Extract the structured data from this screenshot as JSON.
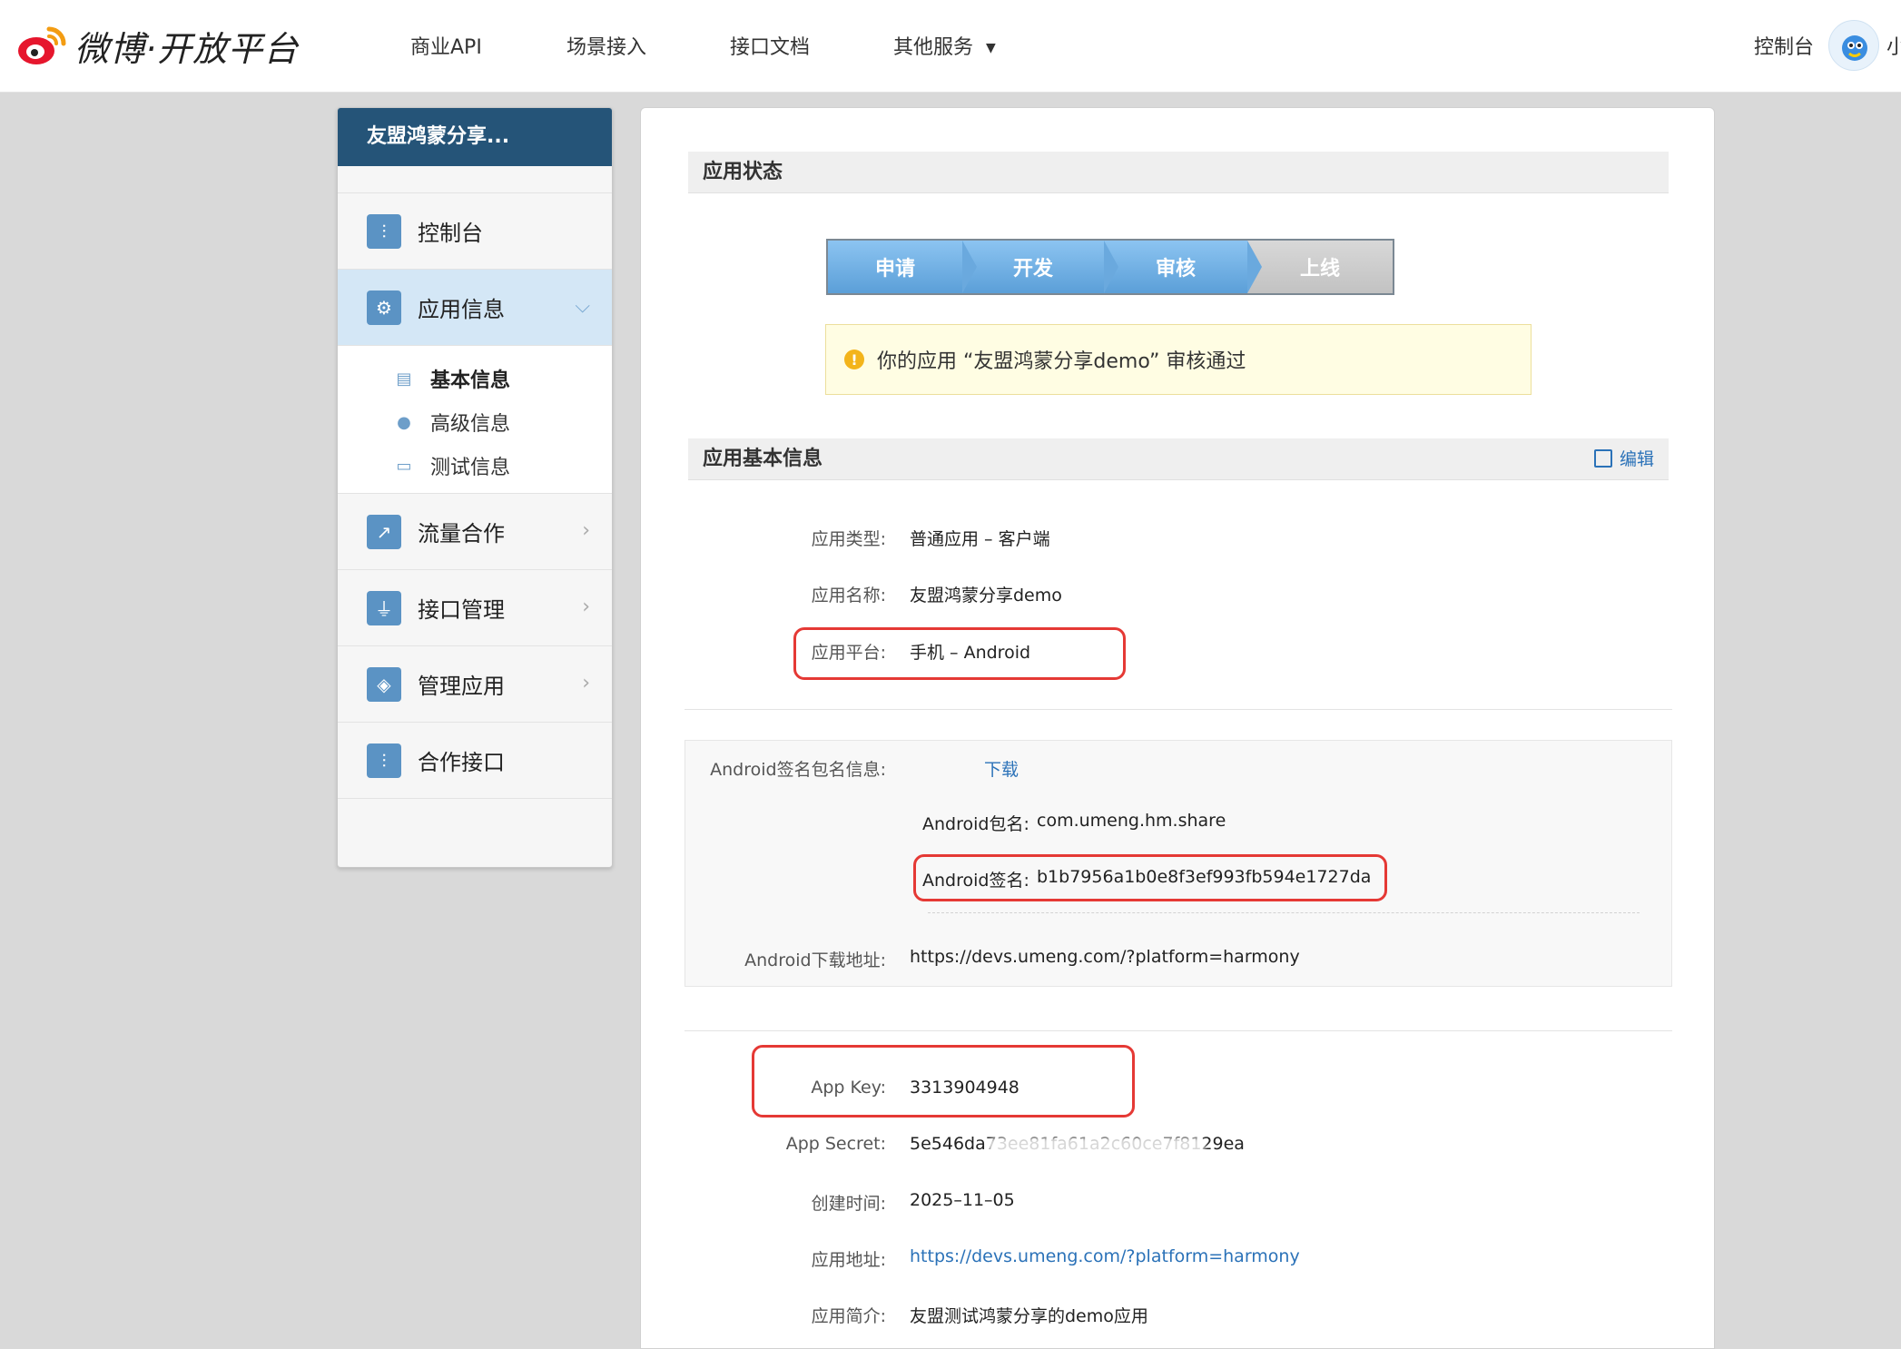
{
  "header": {
    "logo_text": "微博·开放平台",
    "nav": [
      "商业API",
      "场景接入",
      "接口文档",
      "其他服务"
    ],
    "console": "控制台",
    "user_initial": "小"
  },
  "sidebar": {
    "title": "友盟鸿蒙分享...",
    "items": [
      {
        "label": "控制台",
        "icon": "sliders-icon"
      },
      {
        "label": "应用信息",
        "icon": "gear-icon"
      },
      {
        "label": "流量合作",
        "icon": "line-chart-icon"
      },
      {
        "label": "接口管理",
        "icon": "plug-icon"
      },
      {
        "label": "管理应用",
        "icon": "layers-icon"
      },
      {
        "label": "合作接口",
        "icon": "sliders-icon"
      }
    ],
    "subitems": [
      {
        "label": "基本信息",
        "icon": "id-card-icon"
      },
      {
        "label": "高级信息",
        "icon": "info-circle-icon"
      },
      {
        "label": "测试信息",
        "icon": "test-card-icon"
      }
    ]
  },
  "status": {
    "title": "应用状态",
    "steps": [
      "申请",
      "开发",
      "审核",
      "上线"
    ],
    "notice": "你的应用 “友盟鸿蒙分享demo” 审核通过"
  },
  "basic": {
    "title": "应用基本信息",
    "edit": "编辑",
    "app_type_label": "应用类型:",
    "app_type_value": "普通应用 – 客户端",
    "app_name_label": "应用名称:",
    "app_name_value": "友盟鸿蒙分享demo",
    "platform_label": "应用平台:",
    "platform_value": "手机 – Android"
  },
  "android": {
    "sign_info_label": "Android签名包名信息:",
    "download": "下载",
    "package_label": "Android包名:",
    "package_value": "com.umeng.hm.share",
    "sign_label": "Android签名:",
    "sign_value": "b1b7956a1b0e8f3ef993fb594e1727da",
    "download_url_label": "Android下载地址:",
    "download_url_value": "https://devs.umeng.com/?platform=harmony"
  },
  "keys": {
    "app_key_label": "App Key:",
    "app_key_value": "3313904948",
    "app_secret_label": "App Secret:",
    "app_secret_value": "5e546da73ee81fa61a2c60ce7f8129ea",
    "created_label": "创建时间:",
    "created_value": "2025–11–05",
    "url_label": "应用地址:",
    "url_value": "https://devs.umeng.com/?platform=harmony",
    "intro_label": "应用简介:",
    "intro_value": "友盟测试鸿蒙分享的demo应用"
  }
}
